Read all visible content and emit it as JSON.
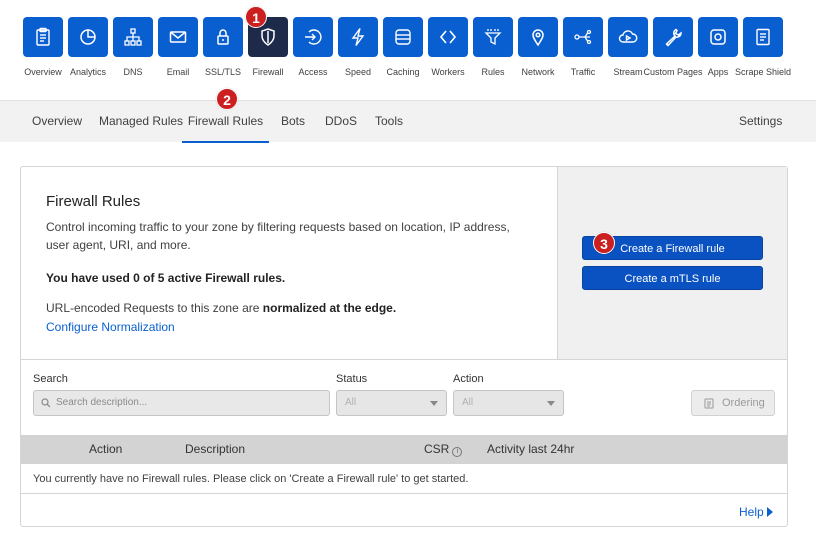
{
  "apps": [
    {
      "id": "overview",
      "label": "Overview",
      "icon": "clipboard-icon"
    },
    {
      "id": "analytics",
      "label": "Analytics",
      "icon": "pie-chart-icon"
    },
    {
      "id": "dns",
      "label": "DNS",
      "icon": "network-tree-icon"
    },
    {
      "id": "email",
      "label": "Email",
      "icon": "envelope-icon"
    },
    {
      "id": "ssl",
      "label": "SSL/TLS",
      "icon": "lock-icon"
    },
    {
      "id": "firewall",
      "label": "Firewall",
      "icon": "shield-icon"
    },
    {
      "id": "access",
      "label": "Access",
      "icon": "access-arrow-icon"
    },
    {
      "id": "speed",
      "label": "Speed",
      "icon": "lightning-icon"
    },
    {
      "id": "caching",
      "label": "Caching",
      "icon": "server-stack-icon"
    },
    {
      "id": "workers",
      "label": "Workers",
      "icon": "code-brackets-icon"
    },
    {
      "id": "rules",
      "label": "Rules",
      "icon": "funnel-icon"
    },
    {
      "id": "network",
      "label": "Network",
      "icon": "map-pin-icon"
    },
    {
      "id": "traffic",
      "label": "Traffic",
      "icon": "share-route-icon"
    },
    {
      "id": "stream",
      "label": "Stream",
      "icon": "cloud-play-icon"
    },
    {
      "id": "custom",
      "label": "Custom Pages",
      "icon": "wrench-icon"
    },
    {
      "id": "apps",
      "label": "Apps",
      "icon": "app-box-icon"
    },
    {
      "id": "scrape",
      "label": "Scrape Shield",
      "icon": "document-icon"
    }
  ],
  "markers": [
    "1",
    "2",
    "3"
  ],
  "subnav": {
    "tabs": [
      "Overview",
      "Managed Rules",
      "Firewall Rules",
      "Bots",
      "DDoS",
      "Tools"
    ],
    "settings": "Settings"
  },
  "intro": {
    "title": "Firewall Rules",
    "description": "Control incoming traffic to your zone by filtering requests based on location, IP address, user agent, URI, and more.",
    "usage": "You have used 0 of 5 active Firewall rules.",
    "url_prefix": "URL-encoded Requests to this zone are ",
    "url_bold": "normalized at the edge.",
    "configure_link": "Configure Normalization"
  },
  "actions": {
    "create_firewall": "Create a Firewall rule",
    "create_mtls": "Create a mTLS rule"
  },
  "filters": {
    "search_label": "Search",
    "search_placeholder": "Search description...",
    "status_label": "Status",
    "status_value": "All",
    "action_label": "Action",
    "action_value": "All",
    "ordering": "Ordering"
  },
  "table": {
    "columns": [
      "Action",
      "Description",
      "CSR",
      "Activity last 24hr"
    ],
    "empty_message": "You currently have no Firewall rules. Please click on 'Create a Firewall rule' to get started."
  },
  "help": "Help",
  "colors": {
    "accent": "#0a5fd0",
    "active_tile": "#1d2a4a",
    "marker": "#cc1f1f"
  }
}
